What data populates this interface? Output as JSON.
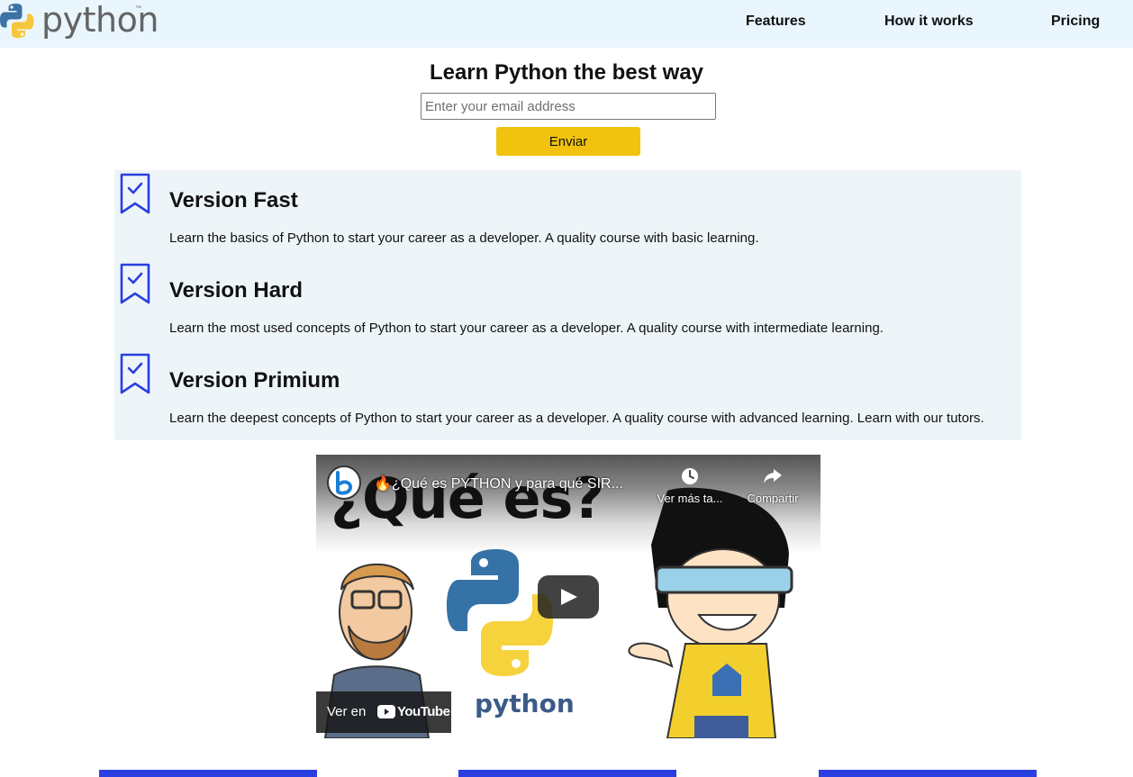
{
  "header": {
    "logo_text": "python",
    "logo_tm": "™",
    "nav": [
      {
        "label": "Features"
      },
      {
        "label": "How it works"
      },
      {
        "label": "Pricing"
      }
    ]
  },
  "hero": {
    "title": "Learn Python the best way",
    "email_placeholder": "Enter your email address",
    "submit_label": "Enviar"
  },
  "features": [
    {
      "title": "Version Fast",
      "description": "Learn the basics of Python to start your career as a developer. A quality course with basic learning.",
      "icon": "bookmark-check-icon"
    },
    {
      "title": "Version Hard",
      "description": "Learn the most used concepts of Python to start your career as a developer. A quality course with intermediate learning.",
      "icon": "bookmark-check-icon"
    },
    {
      "title": "Version Primium",
      "description": "Learn the deepest concepts of Python to start your career as a developer. A quality course with advanced learning. Learn with our tutors.",
      "icon": "bookmark-check-icon"
    }
  ],
  "video": {
    "title": "🔥¿Qué es PYTHON y para qué SIR...",
    "thumbnail_text": "¿Qué es?",
    "watch_later_label": "Ver más ta...",
    "share_label": "Compartir",
    "watch_on_label": "Ver en",
    "youtube_label": "YouTube",
    "thumbnail_python_text": "python"
  },
  "colors": {
    "header_bg": "#eaf6fd",
    "accent_yellow": "#f1c30f",
    "icon_blue": "#2a3fe0",
    "panel_bg": "#eef5f9"
  }
}
